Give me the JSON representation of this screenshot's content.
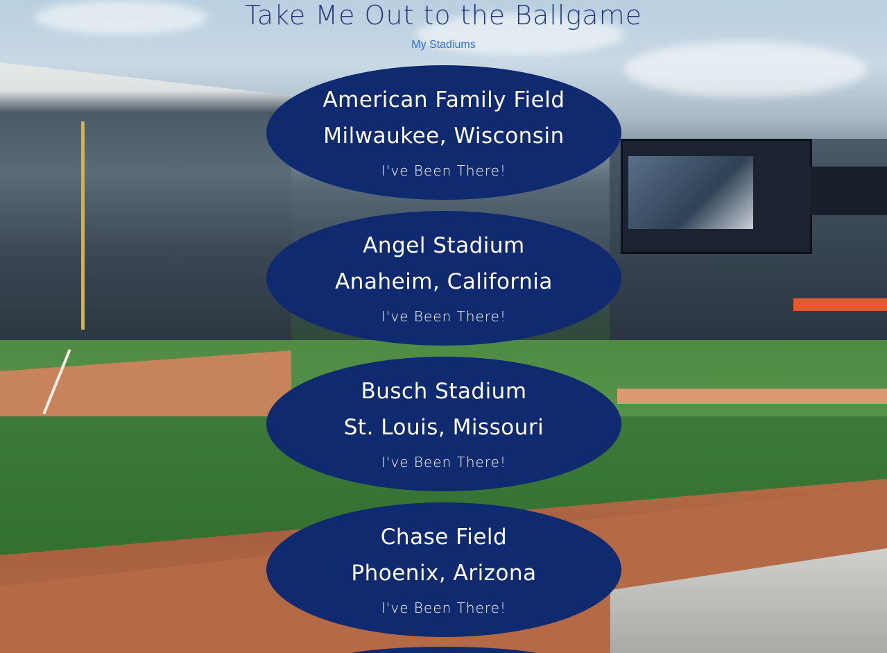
{
  "page": {
    "title": "Take Me Out to the Ballgame",
    "nav_link": "My Stadiums"
  },
  "colors": {
    "title": "#243a7e",
    "link": "#2a6fd6",
    "card": "#0f2a6e",
    "card_text": "#ffffff"
  },
  "stadiums": [
    {
      "name": "American Family Field",
      "location": "Milwaukee, Wisconsin",
      "button": "I've Been There!"
    },
    {
      "name": "Angel Stadium",
      "location": "Anaheim, California",
      "button": "I've Been There!"
    },
    {
      "name": "Busch Stadium",
      "location": "St. Louis, Missouri",
      "button": "I've Been There!"
    },
    {
      "name": "Chase Field",
      "location": "Phoenix, Arizona",
      "button": "I've Been There!"
    }
  ]
}
